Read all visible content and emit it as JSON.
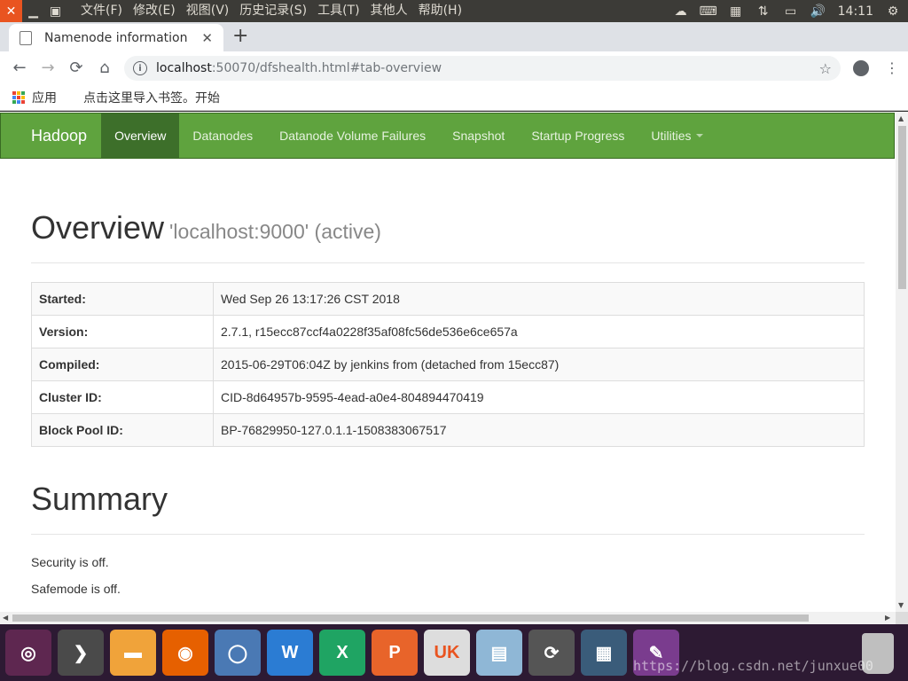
{
  "top_panel": {
    "menus": [
      "文件(F)",
      "修改(E)",
      "视图(V)",
      "历史记录(S)",
      "工具(T)",
      "其他人",
      "帮助(H)"
    ],
    "clock": "14:11"
  },
  "browser": {
    "tab_title": "Namenode information",
    "url_host": "localhost",
    "url_rest": ":50070/dfshealth.html#tab-overview",
    "bookmarks_apps": "应用",
    "bookmarks_hint": "点击这里导入书签。开始"
  },
  "page": {
    "brand": "Hadoop",
    "nav": [
      "Overview",
      "Datanodes",
      "Datanode Volume Failures",
      "Snapshot",
      "Startup Progress",
      "Utilities"
    ],
    "overview_title": "Overview",
    "overview_sub": "'localhost:9000' (active)",
    "info": [
      {
        "key": "Started:",
        "value": "Wed Sep 26 13:17:26 CST 2018"
      },
      {
        "key": "Version:",
        "value": "2.7.1, r15ecc87ccf4a0228f35af08fc56de536e6ce657a"
      },
      {
        "key": "Compiled:",
        "value": "2015-06-29T06:04Z by jenkins from (detached from 15ecc87)"
      },
      {
        "key": "Cluster ID:",
        "value": "CID-8d64957b-9595-4ead-a0e4-804894470419"
      },
      {
        "key": "Block Pool ID:",
        "value": "BP-76829950-127.0.1.1-1508383067517"
      }
    ],
    "summary_title": "Summary",
    "summary_lines": [
      "Security is off.",
      "Safemode is off."
    ]
  },
  "dock": {
    "apps": [
      {
        "name": "ubuntu-launcher",
        "color": "#5e2750",
        "glyph": "◎"
      },
      {
        "name": "terminal-app",
        "color": "#4a4a4a",
        "glyph": "❯"
      },
      {
        "name": "files-app",
        "color": "#f0a33a",
        "glyph": "▬"
      },
      {
        "name": "firefox-app",
        "color": "#e66000",
        "glyph": "◉"
      },
      {
        "name": "chrome-app",
        "color": "#4a79b4",
        "glyph": "◯"
      },
      {
        "name": "wps-writer-app",
        "color": "#2b7cd3",
        "glyph": "W"
      },
      {
        "name": "wps-spreadsheet-app",
        "color": "#1fa463",
        "glyph": "X"
      },
      {
        "name": "wps-presentation-app",
        "color": "#e8642a",
        "glyph": "P"
      },
      {
        "name": "ubuntu-kylin-app",
        "color": "#dddddd",
        "glyph": "UK"
      },
      {
        "name": "software-center-app",
        "color": "#8fb7d6",
        "glyph": "▤"
      },
      {
        "name": "update-app",
        "color": "#555555",
        "glyph": "⟳"
      },
      {
        "name": "workspaces-app",
        "color": "#3a5c7a",
        "glyph": "▦"
      },
      {
        "name": "editor-app",
        "color": "#7a3c8e",
        "glyph": "✎"
      }
    ],
    "watermark": "https://blog.csdn.net/junxue00"
  }
}
